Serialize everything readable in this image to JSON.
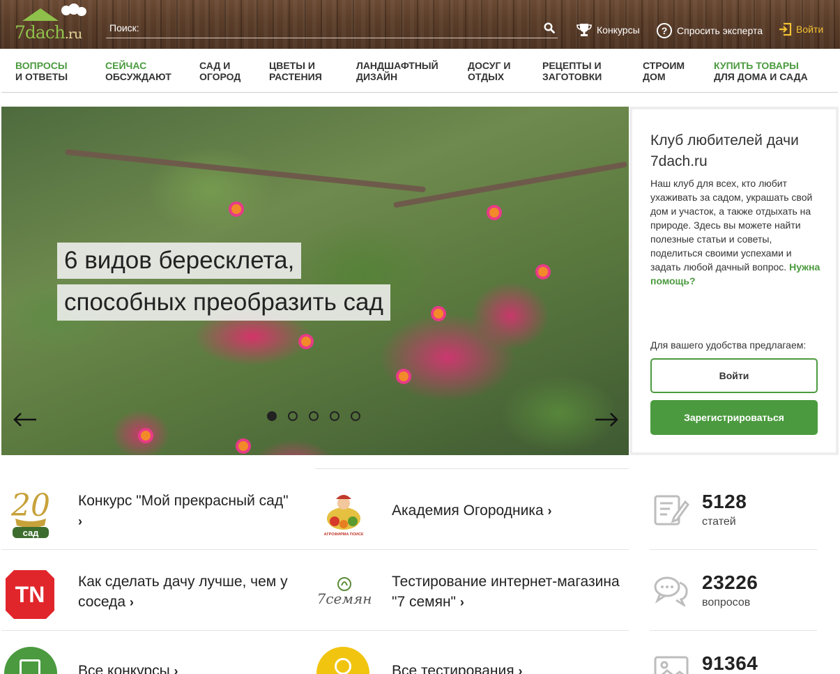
{
  "header": {
    "logo_text": "7dach",
    "logo_suffix": ".ru",
    "search_placeholder": "Поиск:",
    "links": {
      "contests": "Конкурсы",
      "ask_expert": "Спросить эксперта",
      "login": "Войти"
    }
  },
  "nav": [
    {
      "line1": "Вопросы",
      "line2": "и ответы"
    },
    {
      "line1": "Сейчас",
      "line2": "обсуждают"
    },
    {
      "line1": "Сад и",
      "line2": "огород"
    },
    {
      "line1": "Цветы и",
      "line2": "растения"
    },
    {
      "line1": "Ландшафтный",
      "line2": "дизайн"
    },
    {
      "line1": "Досуг и",
      "line2": "отдых"
    },
    {
      "line1": "Рецепты и",
      "line2": "заготовки"
    },
    {
      "line1": "Строим",
      "line2": "дом"
    },
    {
      "line1": "Купить товары",
      "line2": "для дома и сада"
    }
  ],
  "hero": {
    "title_line1": "6 видов бересклета,",
    "title_line2": "способных преобразить сад",
    "slide_count": 5,
    "active_slide": 1
  },
  "club": {
    "title": "Клуб любителей дачи 7dach.ru",
    "text": "Наш клуб для всех, кто любит ухаживать за садом, украшать свой дом и участок, а также отдыхать на природе. Здесь вы можете найти полезные статьи и советы, поделиться своими успехами и задать любой дачный вопрос.",
    "help_link": "Нужна помощь?",
    "offer": "Для вашего удобства предлагаем:",
    "login_button": "Войти",
    "register_button": "Зарегистрироваться"
  },
  "promos": {
    "contest": "Конкурс \"Мой прекрасный сад\"",
    "contest_logo_number": "20",
    "contest_logo_word": "сад",
    "academy": "Академия Огородника",
    "academy_logo_caption": "АГРОФИРМА ПОИСК",
    "better": "Как сделать дачу лучше, чем у соседа",
    "better_logo": "TN",
    "testing": "Тестирование интернет-магазина \"7 семян\"",
    "testing_logo": "7семян",
    "all_contests": "Все конкурсы",
    "all_tests": "Все тестирования"
  },
  "stats": [
    {
      "value": "5128",
      "label": "статей",
      "icon": "article-edit-icon"
    },
    {
      "value": "23226",
      "label": "вопросов",
      "icon": "chat-bubbles-icon"
    },
    {
      "value": "91364",
      "label": "",
      "icon": "photo-icon"
    }
  ],
  "colors": {
    "accent_green": "#4b9a3f",
    "login_yellow": "#f3c233",
    "header_wood": "#5a3d29"
  }
}
